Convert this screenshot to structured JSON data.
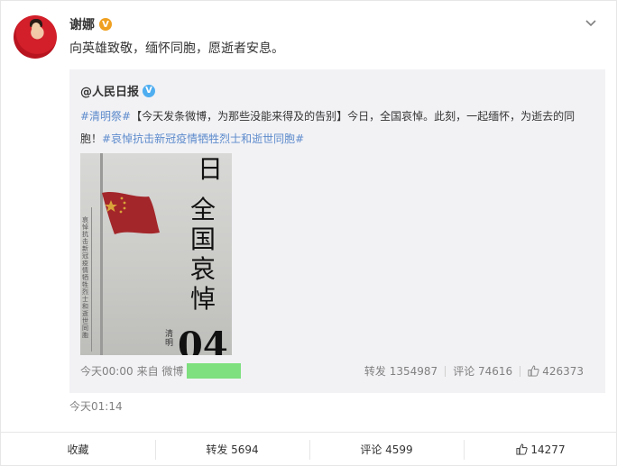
{
  "post": {
    "author": "谢娜",
    "verified_mark": "V",
    "text": "向英雄致敬，缅怀同胞，愿逝者安息。",
    "time": "今天01:14"
  },
  "repost": {
    "source": "@人民日报",
    "verified_mark": "V",
    "tag1": "#清明祭#",
    "body1": "【今天发条微博，为那些没能来得及的告别】今日，全国哀悼。此刻，一起缅怀，为逝去的同胞！",
    "tag2": "#哀悼抗击新冠疫情牺牲烈士和逝世同胞#",
    "poster": {
      "day_char": "日",
      "big_text": "全国哀悼",
      "small_text": "哀悼抗击新冠疫情牺牲烈士和逝世同胞",
      "small_text2": "清明",
      "number": "04"
    },
    "meta_time": "今天00:00",
    "meta_from": "来自 微博",
    "reposts": "转发 1354987",
    "comments": "评论 74616",
    "likes": "426373"
  },
  "actions": {
    "favorite": "收藏",
    "repost": "转发 5694",
    "comment": "评论 4599",
    "like": "14277"
  },
  "colors": {
    "link": "#5d8bcc",
    "verified_orange": "#f0a020",
    "verified_blue": "#4faef0",
    "redaction": "#7ee07e"
  },
  "icons": [
    "chevron-down-icon",
    "thumbs-up-icon",
    "flag-icon"
  ]
}
